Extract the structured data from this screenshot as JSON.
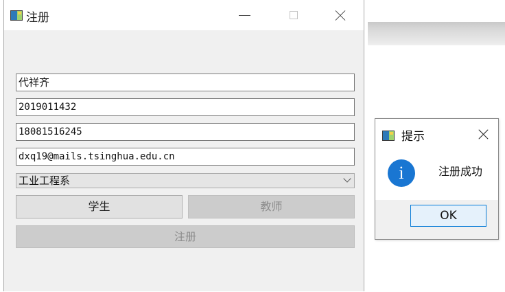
{
  "main_window": {
    "title": "注册",
    "name_value": "代祥齐",
    "student_id_value": "2019011432",
    "phone_value": "18081516245",
    "email_value": "dxq19@mails.tsinghua.edu.cn",
    "department_selected": "工业工程系",
    "student_button": "学生",
    "teacher_button": "教师",
    "register_button": "注册"
  },
  "dialog": {
    "title": "提示",
    "message": "注册成功",
    "info_glyph": "i",
    "ok_button": "OK"
  },
  "colors": {
    "accent": "#0078d7",
    "info_icon": "#1976d2",
    "disabled_text": "#8c8c8c"
  }
}
